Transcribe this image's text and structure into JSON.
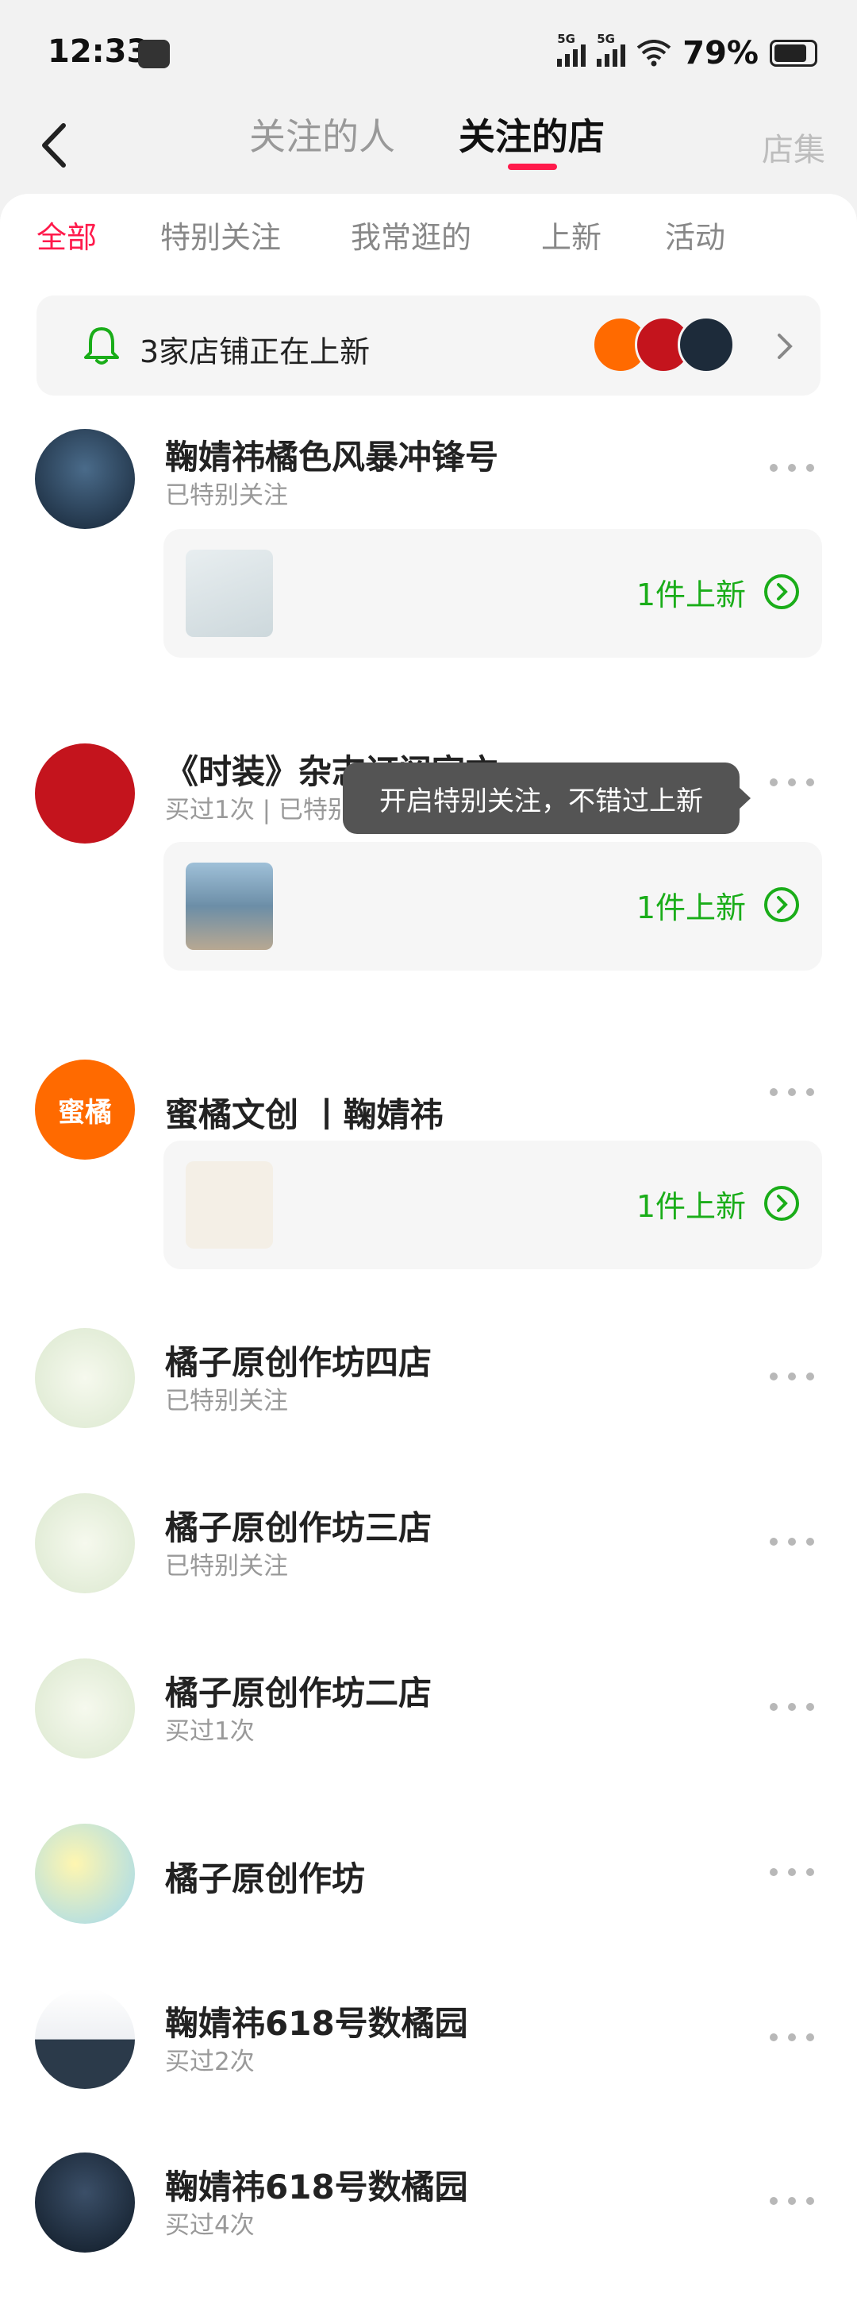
{
  "status_bar": {
    "time": "12:33",
    "battery": "79%",
    "signal_tag": "5G"
  },
  "header": {
    "tab_people": "关注的人",
    "tab_shops": "关注的店",
    "right_link": "店集"
  },
  "filters": [
    "全部",
    "特别关注",
    "我常逛的",
    "上新",
    "活动"
  ],
  "banner": {
    "text": "3家店铺正在上新"
  },
  "tooltip": "开启特别关注，不错过上新",
  "new_label": "1件上新",
  "colors": {
    "accent": "#ff1a4b",
    "green": "#1aad19",
    "tooltip_bg": "#545454"
  },
  "shops": [
    {
      "name": "鞠婧祎橘色风暴冲锋号",
      "sub": "已特别关注",
      "has_new": true
    },
    {
      "name": "《时装》杂志订阅官方",
      "sub": "买过1次 | 已特别关注",
      "has_new": true
    },
    {
      "name": "蜜橘文创 丨鞠婧祎",
      "sub": "",
      "has_new": true,
      "avatar_text": "蜜橘"
    },
    {
      "name": "橘子原创作坊四店",
      "sub": "已特别关注",
      "has_new": false
    },
    {
      "name": "橘子原创作坊三店",
      "sub": "已特别关注",
      "has_new": false
    },
    {
      "name": "橘子原创作坊二店",
      "sub": "买过1次",
      "has_new": false
    },
    {
      "name": "橘子原创作坊",
      "sub": "",
      "has_new": false
    },
    {
      "name": "鞠婧祎618号数橘园",
      "sub": "买过2次",
      "has_new": false
    },
    {
      "name": "鞠婧祎618号数橘园",
      "sub": "买过4次",
      "has_new": false
    }
  ]
}
